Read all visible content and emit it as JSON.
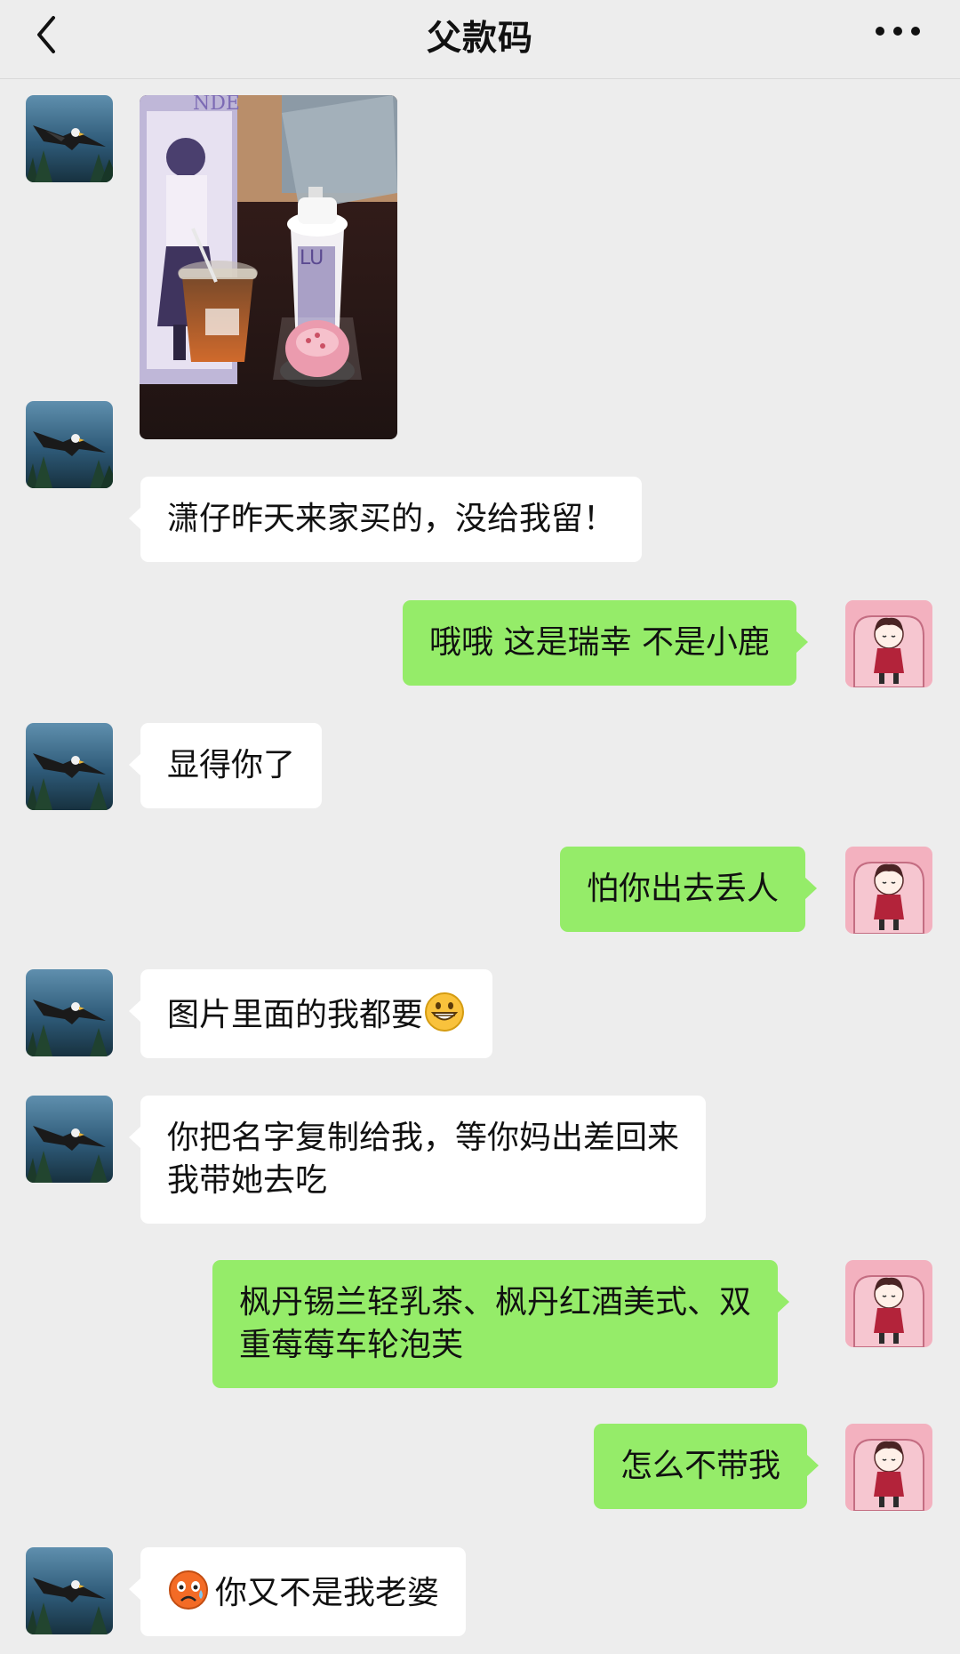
{
  "header": {
    "title": "父款码",
    "back_icon": "chevron-left-icon",
    "more_icon": "more-dots-icon"
  },
  "messages": [
    {
      "side": "left",
      "type": "image",
      "content": "photo-bubble-tea-and-cake"
    },
    {
      "side": "left",
      "type": "text",
      "text": "潇仔昨天来家买的，没给我留！"
    },
    {
      "side": "right",
      "type": "text",
      "text": "哦哦 这是瑞幸 不是小鹿"
    },
    {
      "side": "left",
      "type": "text",
      "text": "显得你了"
    },
    {
      "side": "right",
      "type": "text",
      "text": "怕你出去丢人"
    },
    {
      "side": "left",
      "type": "text",
      "text": "图片里面的我都要",
      "emoji_after": "grinning-face-icon"
    },
    {
      "side": "left",
      "type": "text",
      "text": "你把名字复制给我，等你妈出差回来\n我带她去吃"
    },
    {
      "side": "right",
      "type": "text",
      "text": "枫丹锡兰轻乳茶、枫丹红酒美式、双\n重莓莓车轮泡芙"
    },
    {
      "side": "right",
      "type": "text",
      "text": "怎么不带我"
    },
    {
      "side": "left",
      "type": "text",
      "text": "你又不是我老婆",
      "emoji_before": "crying-face-icon"
    }
  ],
  "colors": {
    "background": "#ededed",
    "incoming_bubble": "#ffffff",
    "outgoing_bubble": "#95ec69"
  },
  "avatars": {
    "contact": "eagle-avatar",
    "self": "cartoon-girl-avatar"
  }
}
